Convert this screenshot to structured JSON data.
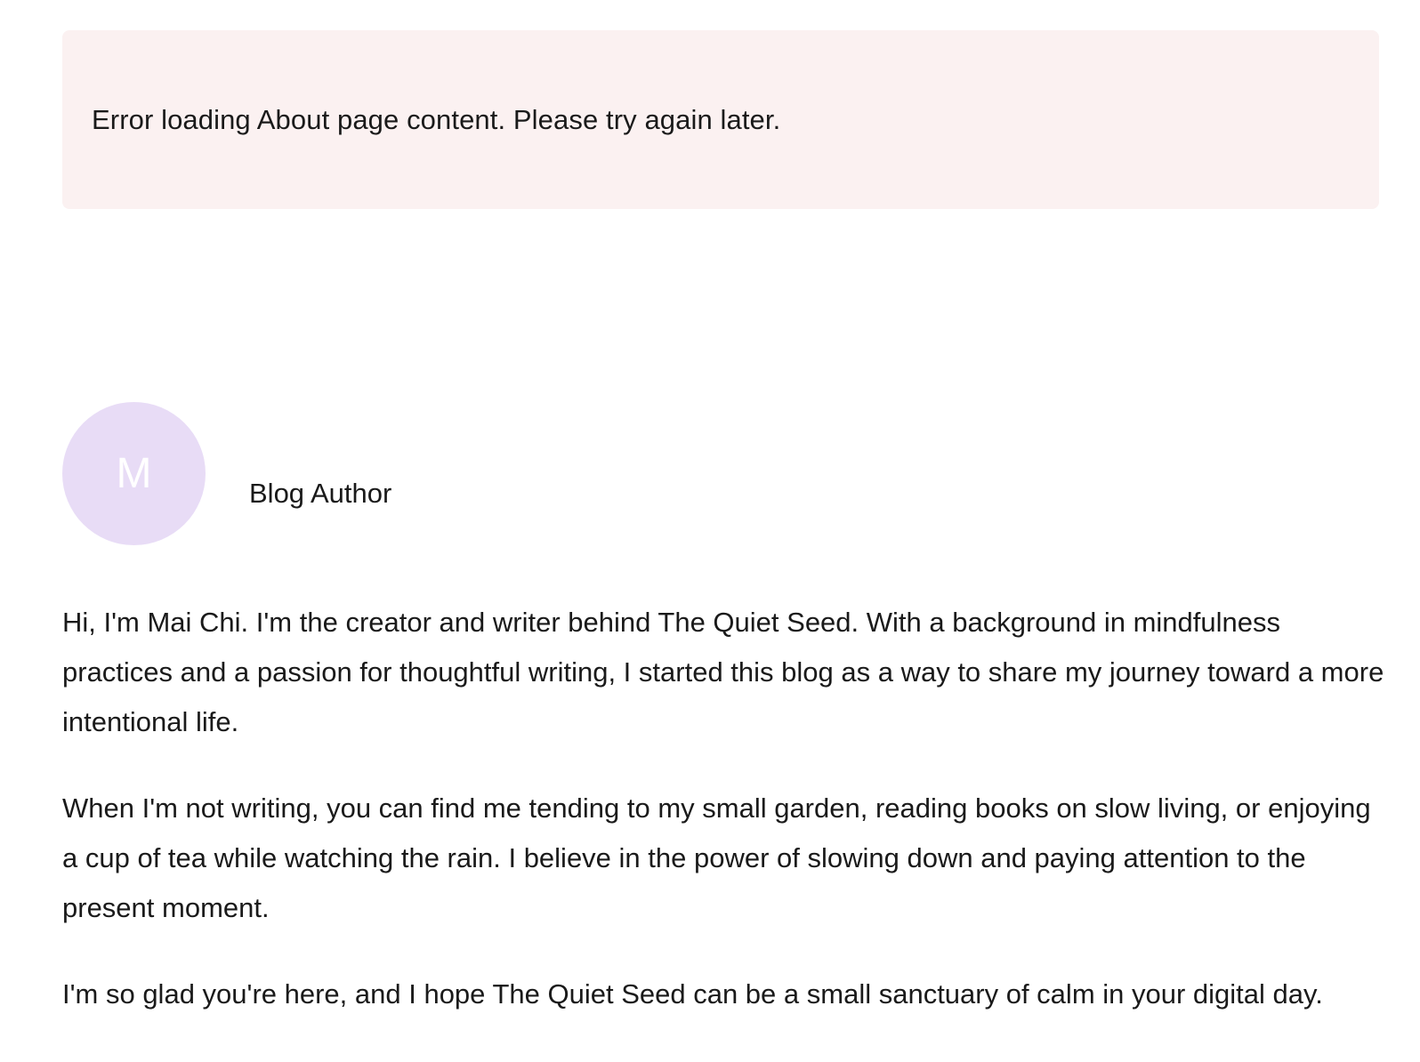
{
  "error": {
    "message": "Error loading About page content. Please try again later."
  },
  "author": {
    "avatar_initial": "M",
    "title": "Blog Author"
  },
  "bio": {
    "paragraphs": [
      "Hi, I'm Mai Chi. I'm the creator and writer behind The Quiet Seed. With a background in mindfulness practices and a passion for thoughtful writing, I started this blog as a way to share my journey toward a more intentional life.",
      "When I'm not writing, you can find me tending to my small garden, reading books on slow living, or enjoying a cup of tea while watching the rain. I believe in the power of slowing down and paying attention to the present moment.",
      "I'm so glad you're here, and I hope The Quiet Seed can be a small sanctuary of calm in your digital day."
    ]
  },
  "colors": {
    "error_background": "#fbf1f1",
    "avatar_background": "#e8dcf6",
    "text": "#1a1a1a"
  }
}
